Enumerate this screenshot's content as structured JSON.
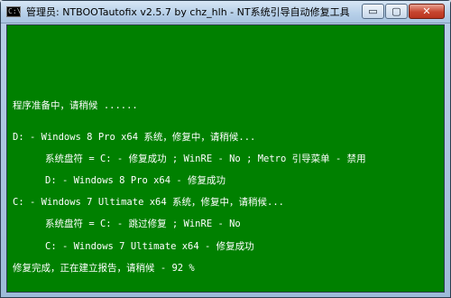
{
  "window": {
    "title": "管理员:  NTBOOTautofix v2.5.7 by chz_hlh - NT系统引导自动修复工具",
    "console_icon_text": "C:\\",
    "controls": {
      "minimize": "▭",
      "maximize": "▢",
      "close": "✕"
    }
  },
  "console": {
    "background_color": "#008000",
    "text_color": "#ffffff",
    "lines": [
      "程序准备中，请稍候 ......",
      "D: - Windows 8 Pro x64 系统，修复中，请稍候...",
      "系统盘符 = C: - 修复成功 ; WinRE - No ; Metro 引导菜单 - 禁用",
      "D: - Windows 8 Pro x64 - 修复成功",
      "C: - Windows 7 Ultimate x64 系统，修复中，请稍候...",
      "系统盘符 = C: - 跳过修复 ; WinRE - No",
      "C: - Windows 7 Ultimate x64 - 修复成功",
      "修复完成，正在建立报告，请稍候 -   92 %"
    ]
  }
}
